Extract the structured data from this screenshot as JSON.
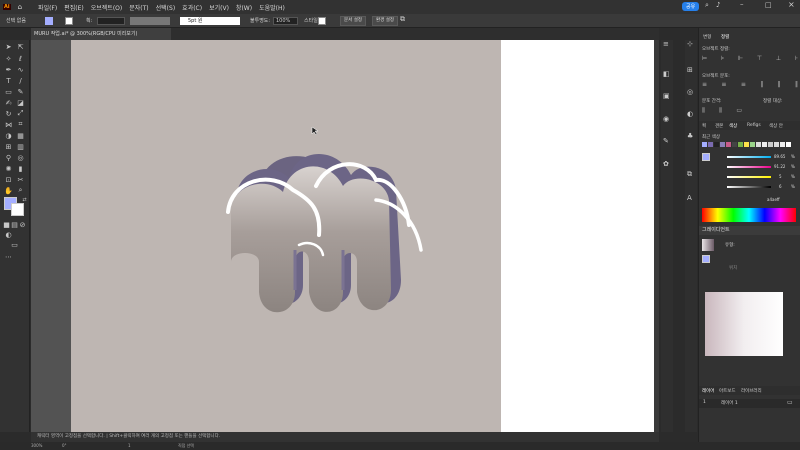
{
  "app": {
    "logo": "Ai"
  },
  "menubar": {
    "items": [
      "파일(F)",
      "편집(E)",
      "오브젝트(O)",
      "문자(T)",
      "선택(S)",
      "효과(C)",
      "보기(V)",
      "창(W)",
      "도움말(H)"
    ],
    "share_label": "공유"
  },
  "control_bar": {
    "selection_label": "선택 없음",
    "stroke_label": "획:",
    "brush_label": "5pt 원",
    "opacity_label": "불투명도:",
    "opacity_value": "100%",
    "style_label": "스타일:",
    "doc_setup_label": "문서 설정",
    "prefs_label": "환경 설정"
  },
  "document": {
    "tab_title": "MURU 작업.ai* @ 300%(RGB/CPU 미리보기)"
  },
  "status": {
    "hint": "캐릭터 영역이 고정점을 선택합니다.  |  Shift+클릭하여 여러 개의 고정점 또는 핸들을 선택합니다.",
    "zoom": "300%",
    "rotate": "0°",
    "page": "1",
    "tool": "직접 선택"
  },
  "panel": {
    "top_tabs": [
      "변형",
      "정렬"
    ],
    "align_objects_label": "오브젝트 정렬:",
    "distribute_objects_label": "오브젝트 분포:",
    "distribute_spacing_label": "분포 간격:",
    "align_to_label": "정렬 대상:",
    "color_tabs": [
      "획",
      "견본",
      "색상",
      "Refigs",
      "색상 안"
    ],
    "recent_label": "최근 색상",
    "color_values": [
      "89.65",
      "91.22",
      "5",
      "6"
    ],
    "color_units": [
      "%",
      "%",
      "%",
      "%"
    ],
    "hex": "a4aeff",
    "gradient_title": "그레이디언트",
    "gradient_type_label": "유형:",
    "gradient_location_label": "위치",
    "layers_tabs": [
      "레이어",
      "아트보드",
      "라이브러리"
    ],
    "layer_number": "1",
    "layer_name": "레이어 1"
  },
  "colors": {
    "fill": "#a4aeff",
    "accent": "#2680eb",
    "art_bg": "#beb6b2"
  }
}
